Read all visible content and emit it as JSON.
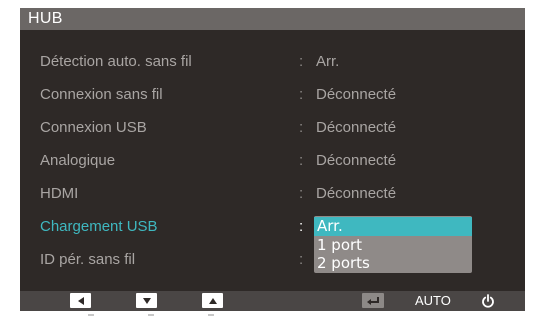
{
  "title": "HUB",
  "rows": [
    {
      "label": "Détection auto. sans fil",
      "colon": ":",
      "value": "Arr."
    },
    {
      "label": "Connexion sans fil",
      "colon": ":",
      "value": "Déconnecté"
    },
    {
      "label": "Connexion USB",
      "colon": ":",
      "value": "Déconnecté"
    },
    {
      "label": "Analogique",
      "colon": ":",
      "value": "Déconnecté"
    },
    {
      "label": "HDMI",
      "colon": ":",
      "value": "Déconnecté"
    },
    {
      "label": "Chargement USB",
      "colon": ":",
      "value": ""
    },
    {
      "label": "ID pér. sans fil",
      "colon": ":",
      "value": ""
    }
  ],
  "active_row": "Chargement USB",
  "dropdown": {
    "options": [
      "Arr.",
      "1 port",
      "2 ports"
    ],
    "selected": "Arr."
  },
  "bottom_bar": {
    "buttons": [
      {
        "icon": "left-arrow-icon"
      },
      {
        "icon": "down-arrow-icon"
      },
      {
        "icon": "up-arrow-icon"
      },
      {
        "icon": "enter-icon"
      },
      {
        "icon": "power-icon"
      }
    ],
    "auto_label": "AUTO"
  },
  "colors": {
    "osd_background": "#2e2927",
    "title_background": "#6b6765",
    "text_normal": "#a9a5a3",
    "accent_active": "#3fb8c0",
    "dropdown_background": "#8f8a88",
    "bottom_bar": "#4a4645"
  }
}
